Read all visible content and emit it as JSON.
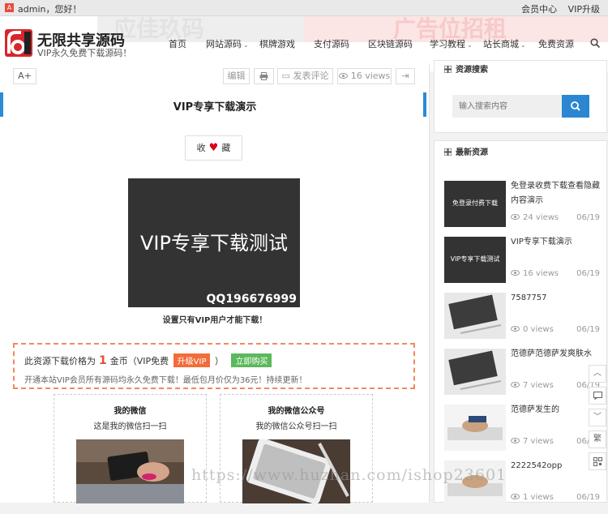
{
  "topbar": {
    "greeting": "admin，您好！",
    "user_icon": "A",
    "links": [
      "会员中心",
      "VIP升级"
    ]
  },
  "site": {
    "title": "无限共享源码",
    "subtitle": "VIP永久免费下载源码！",
    "logo": "6"
  },
  "banner": {
    "left_text": "应佳玖码",
    "right_text": "广告位招租"
  },
  "nav": [
    {
      "label": "首页",
      "dropdown": false
    },
    {
      "label": "网站源码",
      "dropdown": true
    },
    {
      "label": "棋牌游戏",
      "dropdown": false
    },
    {
      "label": "支付源码",
      "dropdown": false
    },
    {
      "label": "区块链源码",
      "dropdown": false
    },
    {
      "label": "学习教程",
      "dropdown": true
    },
    {
      "label": "站长商城",
      "dropdown": true
    },
    {
      "label": "免费资源",
      "dropdown": false
    }
  ],
  "toolbar": {
    "font_size": "A+",
    "edit": "编辑",
    "comment": "发表评论",
    "views": "16 views",
    "share_icon": "share-icon"
  },
  "post": {
    "title": "VIP专享下载演示",
    "favorite_left": "收",
    "favorite_right": "藏",
    "hero_text": "VIP专享下载测试",
    "hero_qq": "QQ196676999",
    "caption": "设置只有VIP用户才能下载！"
  },
  "pay": {
    "prefix": "此资源下载价格为",
    "price": "1",
    "unit": "金币（VIP免费",
    "vip_button": "升级VIP",
    "close_paren": "）",
    "buy_button": "立即购买",
    "note": "开通本站VIP会员所有源码均永久免费下载！最低包月价仅为36元！持续更新！"
  },
  "qr": [
    {
      "title": "我的微信",
      "subtitle": "这是我的微信扫一扫"
    },
    {
      "title": "我的微信公众号",
      "subtitle": "我的微信公众号扫一扫"
    }
  ],
  "sidebar": {
    "search_title": "资源搜索",
    "search_placeholder": "输入搜索内容",
    "latest_title": "最新资源",
    "items": [
      {
        "title": "免登录收费下载查看隐藏内容演示",
        "thumb_text": "免登录付费下载",
        "views": "24 views",
        "date": "06/19"
      },
      {
        "title": "VIP专享下载演示",
        "thumb_text": "VIP专享下载测试",
        "views": "16 views",
        "date": "06/19"
      },
      {
        "title": "7587757",
        "thumb_text": "",
        "views": "0 views",
        "date": "06/19"
      },
      {
        "title": "范德萨范德萨发爽肤水",
        "thumb_text": "",
        "views": "7 views",
        "date": "06/19"
      },
      {
        "title": "范德萨发生的",
        "thumb_text": "",
        "views": "7 views",
        "date": "06/19"
      },
      {
        "title": "2222542opp",
        "thumb_text": "",
        "views": "1 views",
        "date": "06/19"
      }
    ]
  },
  "float_tools": [
    "︿",
    "comment-icon",
    "﹀",
    "繁",
    "qr-icon"
  ],
  "watermark": "https://www.huzhan.com/ishop23601",
  "colors": {
    "accent": "#2b8bd6",
    "vip": "#f26c3a",
    "buy": "#5cb85c",
    "price": "#e74c3c",
    "dashed": "#f08a5d"
  }
}
